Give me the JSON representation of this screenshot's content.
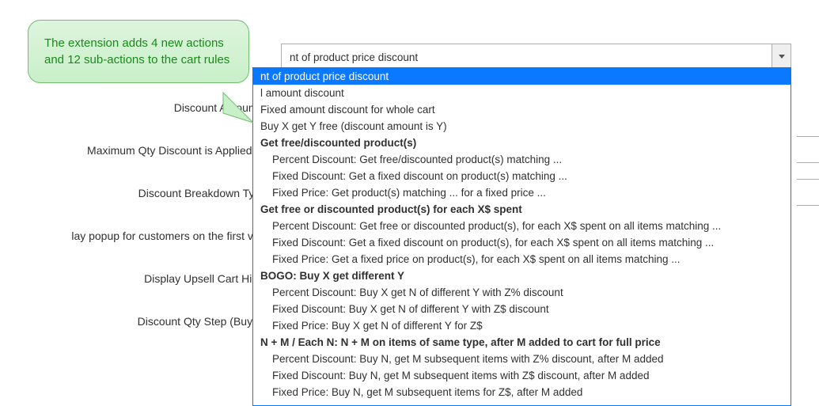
{
  "callout_text": "The extension adds 4 new actions and 12 sub-actions to the cart rules",
  "labels": {
    "discount_amount": "Discount Amount",
    "max_qty": "Maximum Qty Discount is Applied To",
    "breakdown": "Discount Breakdown Type",
    "popup": "lay popup for customers on the first visit",
    "upsell": "Display Upsell Cart Hints",
    "qty_step": "Discount Qty Step (Buy X)"
  },
  "select": {
    "selected_text": "nt of product price discount",
    "selected_value": "Percent of product price discount"
  },
  "options": [
    {
      "text": "nt of product price discount",
      "selected": true
    },
    {
      "text": "l amount discount"
    },
    {
      "text": "----d amount discount for whole cart"
    },
    {
      "text": "Buy X get Y free (discount amount is Y)"
    },
    {
      "text": "Get free/discounted product(s)",
      "bold": true
    },
    {
      "text": "Percent Discount: Get free/discounted product(s) matching ...",
      "sub": true
    },
    {
      "text": "Fixed Discount: Get a fixed discount on product(s) matching ...",
      "sub": true
    },
    {
      "text": "Fixed Price: Get product(s) matching ... for a fixed price ...",
      "sub": true
    },
    {
      "text": "Get free or discounted product(s) for each X$ spent",
      "bold": true
    },
    {
      "text": "Percent Discount: Get free or discounted product(s), for each X$ spent on all items matching ...",
      "sub": true
    },
    {
      "text": "Fixed Discount: Get a fixed discount on product(s), for each X$ spent on all items matching ...",
      "sub": true
    },
    {
      "text": "Fixed Price: Get a fixed price on product(s), for each X$ spent on all items matching ...",
      "sub": true
    },
    {
      "text": "BOGO: Buy X get different Y",
      "bold": true
    },
    {
      "text": "Percent Discount: Buy X get N of different Y with Z% discount",
      "sub": true
    },
    {
      "text": "Fixed Discount: Buy X get N of different Y with Z$ discount",
      "sub": true
    },
    {
      "text": "Fixed Price: Buy X get N of different Y for Z$",
      "sub": true
    },
    {
      "text": "N + M / Each N: N + M on items of same type, after M added to cart for full price",
      "bold": true
    },
    {
      "text": "Percent Discount: Buy N, get M subsequent items with Z% discount, after M added",
      "sub": true
    },
    {
      "text": "Fixed Discount: Buy N, get M subsequent items with Z$ discount, after M added",
      "sub": true
    },
    {
      "text": "Fixed Price: Buy N, get M subsequent items for Z$, after M added",
      "sub": true
    }
  ]
}
